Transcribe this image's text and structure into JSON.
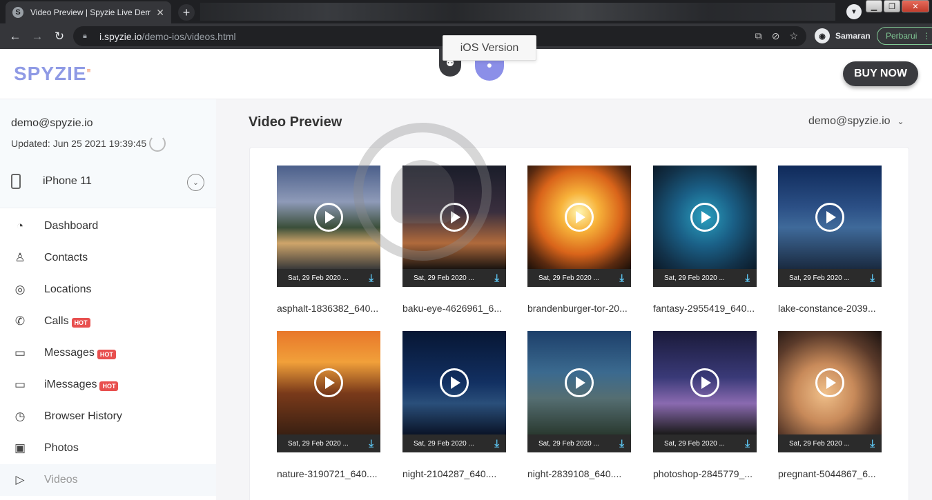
{
  "browser": {
    "tab_title": "Video Preview | Spyzie Live Demo",
    "favicon_letter": "S",
    "new_tab": "+",
    "url_host": "i.spyzie.io",
    "url_path": "/demo-ios/videos.html",
    "profile_name": "Samaran",
    "update_label": "Perbarui"
  },
  "header": {
    "logo": "SPYZIE",
    "tooltip": "iOS Version",
    "buy_now": "BUY NOW"
  },
  "sidebar": {
    "email": "demo@spyzie.io",
    "updated": "Updated: Jun 25 2021 19:39:45",
    "device": "iPhone 11",
    "items": [
      {
        "label": "Dashboard",
        "icon": "gauge-icon",
        "glyph": "◔",
        "hot": ""
      },
      {
        "label": "Contacts",
        "icon": "person-icon",
        "glyph": "♙",
        "hot": ""
      },
      {
        "label": "Locations",
        "icon": "pin-icon",
        "glyph": "◎",
        "hot": ""
      },
      {
        "label": "Calls",
        "icon": "phone-icon",
        "glyph": "✆",
        "hot": "HOT"
      },
      {
        "label": "Messages",
        "icon": "chat-icon",
        "glyph": "▭",
        "hot": "HOT"
      },
      {
        "label": "iMessages",
        "icon": "chat-icon",
        "glyph": "▭",
        "hot": "HOT"
      },
      {
        "label": "Browser History",
        "icon": "clock-icon",
        "glyph": "◷",
        "hot": ""
      },
      {
        "label": "Photos",
        "icon": "image-icon",
        "glyph": "▣",
        "hot": ""
      },
      {
        "label": "Videos",
        "icon": "video-icon",
        "glyph": "▷",
        "hot": ""
      }
    ]
  },
  "main": {
    "title": "Video Preview",
    "user": "demo@spyzie.io",
    "videos": [
      {
        "name": "asphalt-1836382_640...",
        "date": "Sat, 29 Feb 2020 ...",
        "bg": "linear-gradient(180deg,#4b5f8a 0%,#8e9ab8 35%,#3b4f3a 60%,#cfa56a 75%,#3a3a3a 100%)"
      },
      {
        "name": "baku-eye-4626961_6...",
        "date": "Sat, 29 Feb 2020 ...",
        "bg": "linear-gradient(180deg,#1a1d2a 0%,#3a2f3e 45%,#b06a3c 75%,#1a1410 100%)"
      },
      {
        "name": "brandenburger-tor-20...",
        "date": "Sat, 29 Feb 2020 ...",
        "bg": "radial-gradient(circle at 50% 45%,#fff6b0 0%,#f7b23a 25%,#d9641a 55%,#5a2a10 80%,#1a0f08 100%)"
      },
      {
        "name": "fantasy-2955419_640...",
        "date": "Sat, 29 Feb 2020 ...",
        "bg": "radial-gradient(circle at 50% 50%,#2a9fbf 0%,#1a5f86 40%,#12324a 75%,#0b1a28 100%)"
      },
      {
        "name": "lake-constance-2039...",
        "date": "Sat, 29 Feb 2020 ...",
        "bg": "linear-gradient(180deg,#0f2a5a 0%,#2b4f85 40%,#3f6a9a 60%,#1a2a40 100%)"
      },
      {
        "name": "nature-3190721_640....",
        "date": "Sat, 29 Feb 2020 ...",
        "bg": "linear-gradient(180deg,#e8772a 0%,#f1a03a 30%,#7a3a1a 60%,#3a2012 100%)"
      },
      {
        "name": "night-2104287_640....",
        "date": "Sat, 29 Feb 2020 ...",
        "bg": "linear-gradient(180deg,#071633 0%,#123062 50%,#2a4f7a 70%,#0a1428 100%)"
      },
      {
        "name": "night-2839108_640....",
        "date": "Sat, 29 Feb 2020 ...",
        "bg": "linear-gradient(180deg,#1d3f6a 0%,#3b6a8f 40%,#556e72 65%,#2a3a30 100%)"
      },
      {
        "name": "photoshop-2845779_...",
        "date": "Sat, 29 Feb 2020 ...",
        "bg": "linear-gradient(180deg,#1a1a3a 0%,#3a3a78 45%,#8a6ab0 70%,#1a1a1a 100%)"
      },
      {
        "name": "pregnant-5044867_6...",
        "date": "Sat, 29 Feb 2020 ...",
        "bg": "radial-gradient(circle at 45% 60%,#f0c08a 0%,#c88a5a 35%,#5a3a2a 70%,#1a1210 100%)"
      }
    ]
  }
}
